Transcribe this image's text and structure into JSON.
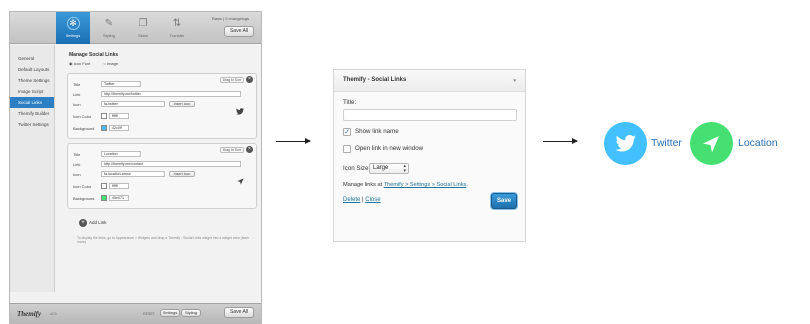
{
  "settings_screen": {
    "tabs": [
      {
        "label": "Settings",
        "icon": "gear-icon",
        "active": true
      },
      {
        "label": "Styling",
        "icon": "pencil-icon",
        "active": false
      },
      {
        "label": "Skins",
        "icon": "skins-icon",
        "active": false
      },
      {
        "label": "Transfer",
        "icon": "transfer-icon",
        "active": false
      }
    ],
    "info": "Basic | 0 changelogs",
    "save_all_label": "Save All",
    "sidebar": [
      {
        "label": "General",
        "active": false
      },
      {
        "label": "Default Layouts",
        "active": false
      },
      {
        "label": "Theme Settings",
        "active": false
      },
      {
        "label": "Image Script",
        "active": false
      },
      {
        "label": "Social Links",
        "active": true
      },
      {
        "label": "Themify Builder",
        "active": false
      },
      {
        "label": "Twitter Settings",
        "active": false
      }
    ],
    "heading": "Manage Social Links",
    "radio_options": [
      "Icon Font",
      "Image"
    ],
    "drag_label": "Drag to Sort",
    "field_labels": {
      "title": "Title",
      "link": "Link",
      "icon": "Icon",
      "icon_color": "Icon Color",
      "background": "Background"
    },
    "insert_icon_label": "Insert Icon",
    "links": [
      {
        "title": "Twitter",
        "link": "http://themify.me/twitter",
        "icon": "fa-twitter",
        "icon_color": "ffffff",
        "background": "42c0ff",
        "swatch_icon": "#ffffff",
        "swatch_bg": "#42c0ff",
        "glyph": "twitter-icon"
      },
      {
        "title": "Location",
        "link": "http://themify.me/contact",
        "icon": "fa-location-arrow",
        "icon_color": "ffffff",
        "background": "45e071",
        "swatch_icon": "#ffffff",
        "swatch_bg": "#45e071",
        "glyph": "location-arrow-icon"
      }
    ],
    "add_link_label": "Add Link",
    "note": "To display the links, go to Appearance > Widgets and drop a Themify - Social Links widget into a widget area (learn more)",
    "footer": {
      "logo": "Themify",
      "version": "v2.0",
      "reset_label": "RESET",
      "tab_settings": "Settings",
      "tab_styling": "Styling",
      "save_all_label": "Save All"
    }
  },
  "widget": {
    "title": "Themify - Social Links",
    "title_field_label": "Title:",
    "show_link_name_label": "Show link name",
    "show_link_name_checked": true,
    "new_window_label": "Open link in new window",
    "new_window_checked": false,
    "icon_size_label": "Icon Size",
    "icon_size_value": "Large",
    "manage_prefix": "Manage links at ",
    "manage_link": "Themify > Settings > Social Links",
    "manage_suffix": ".",
    "delete_label": "Delete",
    "separator": "|",
    "close_label": "Close",
    "save_label": "Save"
  },
  "output": [
    {
      "label": "Twitter",
      "icon": "twitter-bird-icon",
      "color": "#42c0ff"
    },
    {
      "label": "Location",
      "icon": "location-arrow-icon",
      "color": "#45e071"
    }
  ]
}
